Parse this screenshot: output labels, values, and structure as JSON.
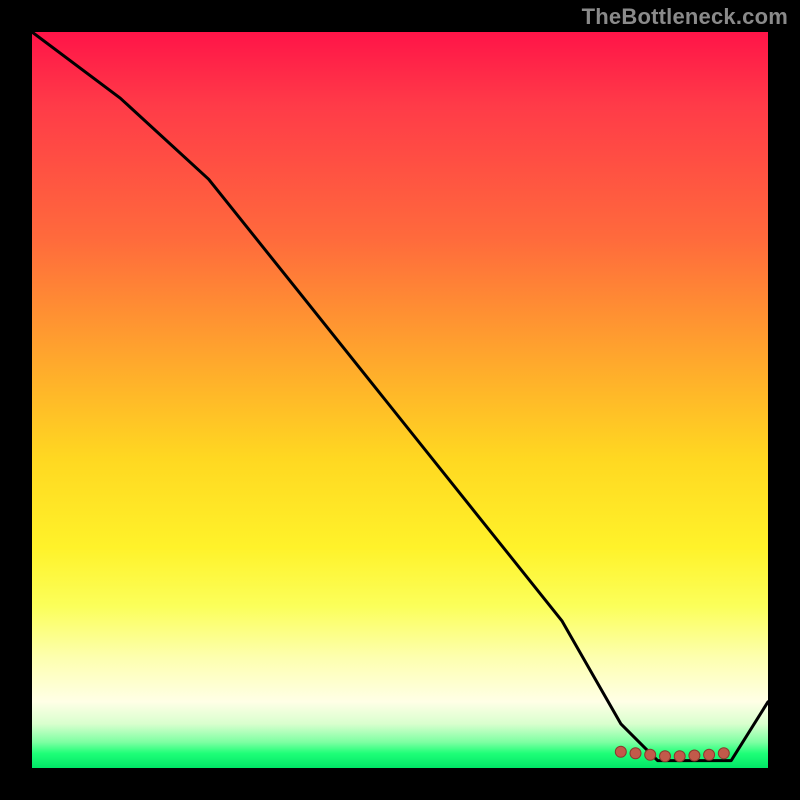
{
  "attribution": "TheBottleneck.com",
  "colors": {
    "page_bg": "#000000",
    "attribution_text": "#8a8a8a",
    "curve": "#000000",
    "dot_fill": "#c25a4a",
    "dot_stroke": "#8a3a2e"
  },
  "chart_data": {
    "type": "line",
    "title": "",
    "xlabel": "",
    "ylabel": "",
    "xlim": [
      0,
      100
    ],
    "ylim": [
      0,
      100
    ],
    "background_gradient": "red-yellow-green (top to bottom)",
    "series": [
      {
        "name": "curve",
        "x": [
          0,
          12,
          24,
          36,
          48,
          60,
          72,
          80,
          85,
          90,
          95,
          100
        ],
        "y": [
          100,
          91,
          80,
          65,
          50,
          35,
          20,
          6,
          1,
          1,
          1,
          9
        ]
      }
    ],
    "dots": {
      "x": [
        80,
        82,
        84,
        86,
        88,
        90,
        92,
        94
      ],
      "y": [
        2.2,
        2.0,
        1.8,
        1.6,
        1.6,
        1.7,
        1.8,
        2.0
      ]
    }
  }
}
